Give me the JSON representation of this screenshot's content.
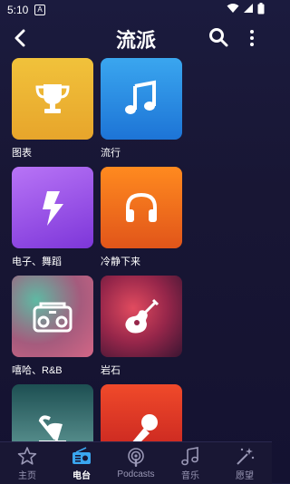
{
  "status": {
    "time": "5:10",
    "notification": "A"
  },
  "header": {
    "title": "流派"
  },
  "genres": [
    {
      "label": "图表",
      "icon": "trophy-icon"
    },
    {
      "label": "流行",
      "icon": "music-note-icon"
    },
    {
      "label": "电子、舞蹈",
      "icon": "lightning-icon"
    },
    {
      "label": "冷静下来",
      "icon": "headphones-icon"
    },
    {
      "label": "嘻哈、R&B",
      "icon": "boombox-icon"
    },
    {
      "label": "岩石",
      "icon": "guitar-icon"
    },
    {
      "label": "",
      "icon": "gramophone-icon"
    },
    {
      "label": "",
      "icon": "microphone-icon"
    }
  ],
  "tabs": [
    {
      "label": "主页",
      "icon": "star-icon"
    },
    {
      "label": "电台",
      "icon": "radio-icon",
      "active": true
    },
    {
      "label": "Podcasts",
      "icon": "podcast-icon"
    },
    {
      "label": "音乐",
      "icon": "music-notes-icon"
    },
    {
      "label": "愿望",
      "icon": "magic-wand-icon"
    }
  ]
}
